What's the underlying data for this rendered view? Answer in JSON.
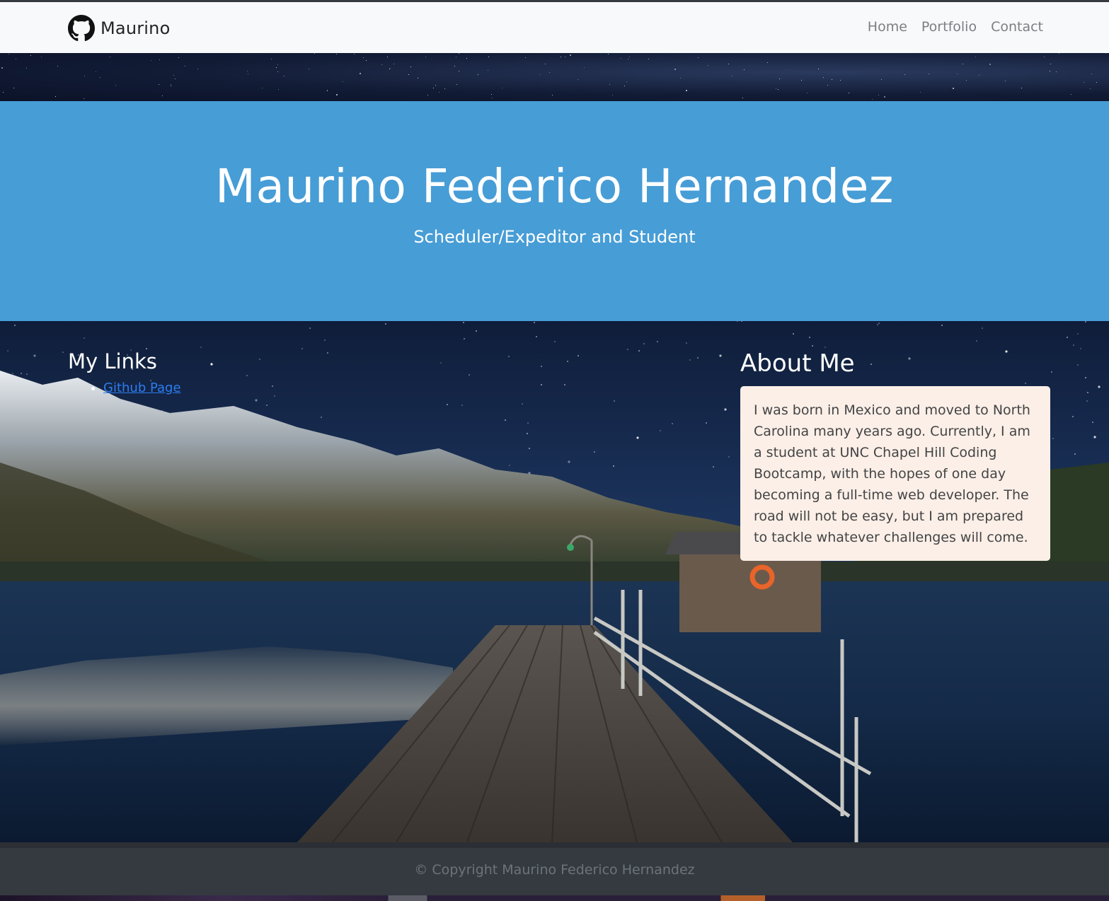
{
  "navbar": {
    "brand": "Maurino",
    "links": [
      "Home",
      "Portfolio",
      "Contact"
    ]
  },
  "hero": {
    "title": "Maurino Federico Hernandez",
    "subtitle": "Scheduler/Expeditor and Student"
  },
  "links_section": {
    "heading": "My Links",
    "items": [
      "Github Page"
    ]
  },
  "about": {
    "heading": "About Me",
    "body": "I was born in Mexico and moved to North Carolina many years ago. Currently, I am a student at UNC Chapel Hill Coding Bootcamp, with the hopes of one day becoming a full-time web developer. The road will not be easy, but I am prepared to tackle whatever challenges will come."
  },
  "footer": {
    "copyright": "© Copyright Maurino Federico Hernandez"
  },
  "icons": {
    "brand_icon": "github-icon"
  },
  "colors": {
    "hero_bg": "#479dd6",
    "navbar_bg": "#f8f9fa",
    "footer_bg": "#343a40",
    "about_card_bg": "#fbefe8",
    "link": "#2c7df0"
  }
}
